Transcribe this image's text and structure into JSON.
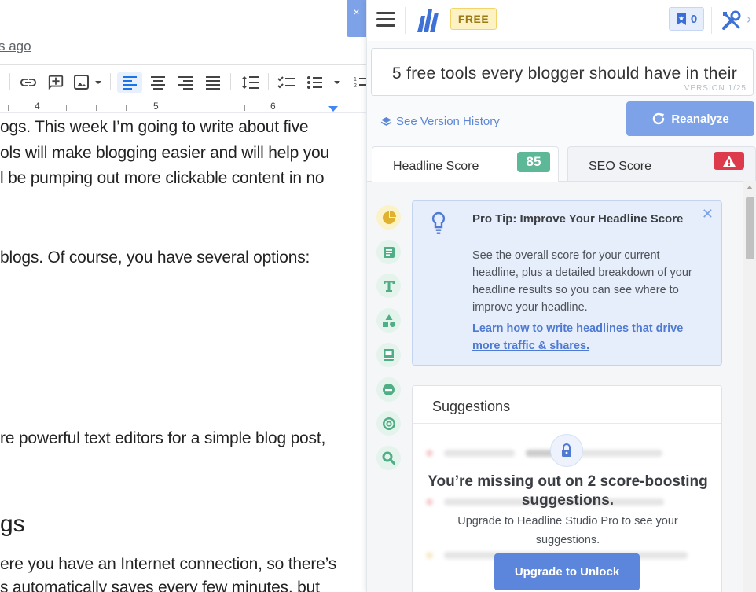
{
  "doc": {
    "edited_text": "s ago",
    "close_label": "×",
    "ruler": [
      "4",
      "5",
      "6"
    ],
    "lines": [
      "ogs. This week I’m going to write about five",
      "ols will make blogging easier and will help you",
      "l be pumping out more clickable content in no",
      "blogs. Of course, you have several options:",
      "re powerful text editors for a simple blog post,",
      "gs",
      "ere you have an Internet connection, so there’s",
      "s automatically saves every few minutes, but"
    ]
  },
  "panel": {
    "free_label": "FREE",
    "bookmark_count": "0",
    "headline": "5 free tools every blogger should have in their",
    "version_label": "VERSION 1/25",
    "see_history": "See Version History",
    "reanalyze": "Reanalyze",
    "tabs": [
      {
        "label": "Headline Score",
        "badge": "85"
      },
      {
        "label": "SEO Score",
        "badge_icon": "warning-icon"
      }
    ],
    "sidebar_icons": [
      "pie-chart-icon",
      "lines-icon",
      "text-icon",
      "shapes-icon",
      "book-icon",
      "emotion-icon",
      "target-icon",
      "search-icon"
    ],
    "protip": {
      "title": "Pro Tip: Improve Your Headline Score",
      "body": "See the overall score for your current headline, plus a detailed breakdown of your headline results so you can see where to improve your headline.",
      "link": "Learn how to write headlines that drive more traffic & shares.",
      "close": "✕"
    },
    "suggestions": {
      "title": "Suggestions",
      "missing": "You’re missing out on 2 score-boosting suggestions.",
      "upgrade_text": "Upgrade to Headline Studio Pro to see your suggestions.",
      "unlock_button": "Upgrade to Unlock"
    }
  },
  "colors": {
    "accent": "#7ea2e8",
    "score_green": "#5cb896",
    "warning_red": "#dd3b4c",
    "free_yellow": "#fdf2c4"
  }
}
